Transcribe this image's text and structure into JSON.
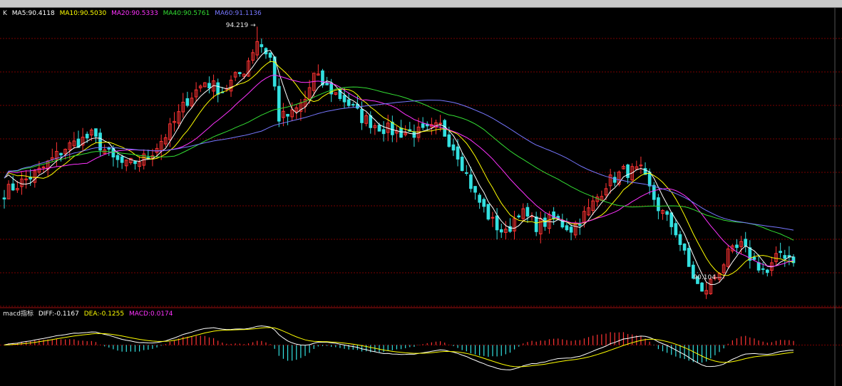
{
  "k_legend": {
    "prefix": "K",
    "items": [
      {
        "text": "MA5:90.4118",
        "color": "#ffffff"
      },
      {
        "text": "MA10:90.5030",
        "color": "#ffff00"
      },
      {
        "text": "MA20:90.5333",
        "color": "#ff33ff"
      },
      {
        "text": "MA40:90.5761",
        "color": "#33dd33"
      },
      {
        "text": "MA60:91.1136",
        "color": "#7777ff"
      }
    ]
  },
  "macd_legend": {
    "prefix": "macd指标",
    "items": [
      {
        "text": "DIFF:-0.1167",
        "color": "#ffffff"
      },
      {
        "text": "DEA:-0.1255",
        "color": "#ffff00"
      },
      {
        "text": "MACD:0.0174",
        "color": "#ff33ff"
      }
    ]
  },
  "annotations": {
    "high_label": "94.219",
    "low_label": "90.104"
  },
  "colors": {
    "background": "#000000",
    "grid": "#7a0000",
    "up_candle": "#ff3333",
    "down_candle": "#33e0e0",
    "ma5": "#ffffff",
    "ma10": "#ffff00",
    "ma20": "#ff33ff",
    "ma40": "#33dd33",
    "ma60": "#7777ff",
    "diff_line": "#ffffff",
    "dea_line": "#ffff00"
  },
  "chart_data": [
    {
      "type": "candlestick",
      "title": "K",
      "ylim": [
        89.55,
        94.45
      ],
      "price_knots": [
        [
          0,
          91.45
        ],
        [
          8,
          91.8
        ],
        [
          14,
          92.2
        ],
        [
          20,
          92.4
        ],
        [
          25,
          92.0
        ],
        [
          28,
          91.9
        ],
        [
          33,
          92.05
        ],
        [
          38,
          92.5
        ],
        [
          42,
          93.0
        ],
        [
          46,
          93.3
        ],
        [
          50,
          93.15
        ],
        [
          55,
          93.5
        ],
        [
          58,
          94.0
        ],
        [
          61,
          93.7
        ],
        [
          63,
          92.7
        ],
        [
          66,
          92.75
        ],
        [
          69,
          93.0
        ],
        [
          71,
          93.4
        ],
        [
          74,
          93.2
        ],
        [
          78,
          93.0
        ],
        [
          82,
          92.7
        ],
        [
          86,
          92.55
        ],
        [
          90,
          92.45
        ],
        [
          96,
          92.45
        ],
        [
          100,
          92.55
        ],
        [
          104,
          92.1
        ],
        [
          108,
          91.4
        ],
        [
          112,
          90.95
        ],
        [
          115,
          90.75
        ],
        [
          118,
          91.15
        ],
        [
          122,
          90.9
        ],
        [
          126,
          91.0
        ],
        [
          130,
          90.85
        ],
        [
          134,
          91.15
        ],
        [
          138,
          91.6
        ],
        [
          142,
          91.8
        ],
        [
          146,
          91.8
        ],
        [
          150,
          91.2
        ],
        [
          154,
          90.8
        ],
        [
          157,
          90.2
        ],
        [
          160,
          89.75
        ],
        [
          163,
          90.05
        ],
        [
          166,
          90.4
        ],
        [
          169,
          90.55
        ],
        [
          172,
          90.3
        ],
        [
          175,
          90.1
        ],
        [
          178,
          90.45
        ],
        [
          181,
          90.35
        ]
      ],
      "series": [
        {
          "name": "MA5",
          "period": 5,
          "value": 90.4118
        },
        {
          "name": "MA10",
          "period": 10,
          "value": 90.503
        },
        {
          "name": "MA20",
          "period": 20,
          "value": 90.5333
        },
        {
          "name": "MA40",
          "period": 40,
          "value": 90.5761
        },
        {
          "name": "MA60",
          "period": 60,
          "value": 91.1136
        }
      ],
      "high": 94.219,
      "low": 90.104,
      "bars": 182
    },
    {
      "type": "bar",
      "title": "macd指标",
      "ylim": [
        -0.75,
        0.6
      ],
      "series": [
        {
          "name": "DIFF",
          "value": -0.1167
        },
        {
          "name": "DEA",
          "value": -0.1255
        },
        {
          "name": "MACD",
          "value": 0.0174
        }
      ],
      "grid": true
    }
  ]
}
